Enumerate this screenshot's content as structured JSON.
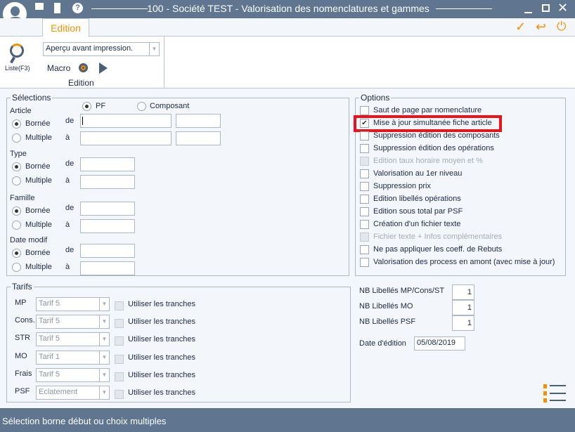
{
  "window": {
    "title": "100 - Société TEST - Valorisation des nomenclatures et gammes"
  },
  "tabs": [
    {
      "label": "Edition",
      "active": true
    }
  ],
  "ribbon": {
    "list_label": "Liste(F3)",
    "output_select": "Aperçu avant impression.",
    "macro_label": "Macro",
    "group_label": "Edition"
  },
  "selections": {
    "legend": "Sélections",
    "pf": "PF",
    "composant": "Composant",
    "pf_selected": true,
    "de": "de",
    "a": "à",
    "borne": "Bornée",
    "multiple": "Multiple",
    "groups": [
      {
        "label": "Article"
      },
      {
        "label": "Type"
      },
      {
        "label": "Famille"
      },
      {
        "label": "Date modif"
      }
    ]
  },
  "options": {
    "legend": "Options",
    "items": [
      {
        "label": "Saut de page par nomenclature",
        "checked": false,
        "disabled": false
      },
      {
        "label": "Mise à jour simultanée fiche article",
        "checked": true,
        "disabled": false,
        "highlighted": true
      },
      {
        "label": "Suppression édition des composants",
        "checked": false,
        "disabled": false
      },
      {
        "label": "Suppression édition des opérations",
        "checked": false,
        "disabled": false
      },
      {
        "label": "Edition taux horaire moyen et %",
        "checked": false,
        "disabled": true
      },
      {
        "label": "Valorisation au 1er niveau",
        "checked": false,
        "disabled": false
      },
      {
        "label": "Suppression prix",
        "checked": false,
        "disabled": false
      },
      {
        "label": "Edition libellés opérations",
        "checked": false,
        "disabled": false
      },
      {
        "label": "Edition sous total par PSF",
        "checked": false,
        "disabled": false
      },
      {
        "label": "Création d'un fichier texte",
        "checked": false,
        "disabled": false
      },
      {
        "label": "Fichier texte + Infos complémentaires",
        "checked": false,
        "disabled": true
      },
      {
        "label": "Ne pas appliquer les coeff. de Rebuts",
        "checked": false,
        "disabled": false
      },
      {
        "label": "Valorisation des process en amont (avec mise à jour)",
        "checked": false,
        "disabled": false
      }
    ]
  },
  "tarifs": {
    "legend": "Tarifs",
    "tranches_label": "Utiliser les tranches",
    "rows": [
      {
        "label": "MP",
        "value": "Tarif 5"
      },
      {
        "label": "Cons.",
        "value": "Tarif 5"
      },
      {
        "label": "STR",
        "value": "Tarif 5"
      },
      {
        "label": "MO",
        "value": "Tarif 1"
      },
      {
        "label": "Frais",
        "value": "Tarif 5"
      },
      {
        "label": "PSF",
        "value": "Eclatement"
      }
    ]
  },
  "right": {
    "nb": [
      {
        "label": "NB Libellés MP/Cons/ST",
        "value": "1"
      },
      {
        "label": "NB Libellés MO",
        "value": "1"
      },
      {
        "label": "NB Libellés PSF",
        "value": "1"
      }
    ],
    "date_label": "Date d'édition",
    "date_value": "05/08/2019"
  },
  "status": {
    "text": "Sélection borne début ou choix multiples"
  },
  "colors": {
    "titlebar": "#5f7590",
    "accent": "#f39200",
    "highlight": "#e8141c"
  }
}
